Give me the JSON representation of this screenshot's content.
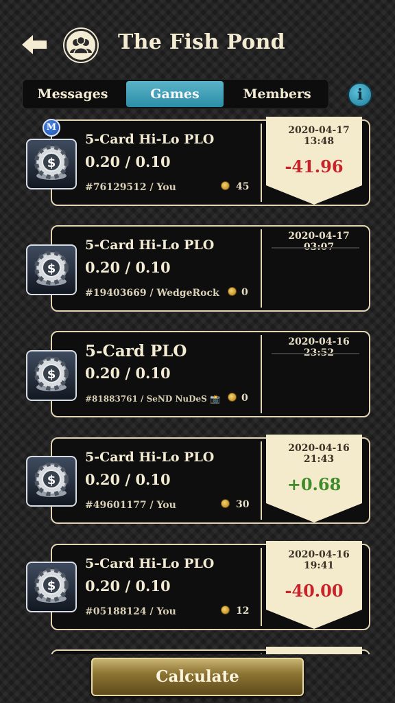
{
  "header": {
    "title": "The Fish Pond",
    "back_icon": "arrow-left-icon",
    "club_icon": "group-icon"
  },
  "tabs": [
    {
      "label": "Messages",
      "active": false
    },
    {
      "label": "Games",
      "active": true
    },
    {
      "label": "Members",
      "active": false
    }
  ],
  "info_icon": {
    "name": "info-icon",
    "glyph": "i"
  },
  "manager_badge": "M",
  "games": [
    {
      "name": "5-Card Hi-Lo PLO",
      "stakes": "0.20 / 0.10",
      "id_owner": "#76129512 / You",
      "coins": "45",
      "datetime": "2020-04-17 13:48",
      "result": "-41.96",
      "result_color": "#c8232b"
    },
    {
      "name": "5-Card Hi-Lo PLO",
      "stakes": "0.20 / 0.10",
      "id_owner": "#19403669 / WedgeRock",
      "coins": "0",
      "datetime": "2020-04-17 03:07",
      "result": "",
      "result_color": ""
    },
    {
      "name": "5-Card PLO",
      "stakes": "0.20 / 0.10",
      "id_owner": "#81883761 / SeND NuDeS 📸",
      "coins": "0",
      "datetime": "2020-04-16 23:52",
      "result": "",
      "result_color": ""
    },
    {
      "name": "5-Card Hi-Lo PLO",
      "stakes": "0.20 / 0.10",
      "id_owner": "#49601177 / You",
      "coins": "30",
      "datetime": "2020-04-16 21:43",
      "result": "+0.68",
      "result_color": "#3f8a2a"
    },
    {
      "name": "5-Card Hi-Lo PLO",
      "stakes": "0.20 / 0.10",
      "id_owner": "#05188124 / You",
      "coins": "12",
      "datetime": "2020-04-16 19:41",
      "result": "-40.00",
      "result_color": "#c8232b"
    }
  ],
  "colors": {
    "accent_teal": "#3a9fb8",
    "card_border": "#e2d6b4",
    "tag_cream": "#f4ebcc",
    "loss_red": "#c8232b",
    "win_green": "#3f8a2a"
  },
  "calculate_button": {
    "label": "Calculate"
  }
}
